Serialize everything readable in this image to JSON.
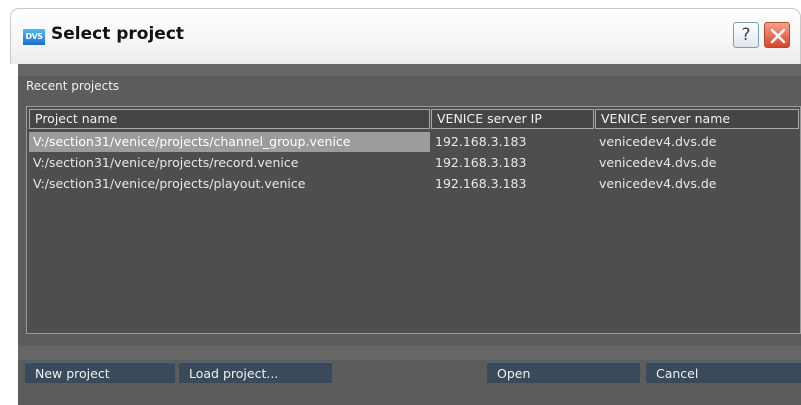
{
  "window": {
    "title": "Select project",
    "logo_text": "DVS",
    "help_label": "?"
  },
  "recent": {
    "label": "Recent projects",
    "columns": [
      "Project name",
      "VENICE server IP",
      "VENICE server name"
    ],
    "rows": [
      {
        "name": "V:/section31/venice/projects/channel_group.venice",
        "ip": "192.168.3.183",
        "server": "venicedev4.dvs.de",
        "selected": true
      },
      {
        "name": "V:/section31/venice/projects/record.venice",
        "ip": "192.168.3.183",
        "server": "venicedev4.dvs.de",
        "selected": false
      },
      {
        "name": "V:/section31/venice/projects/playout.venice",
        "ip": "192.168.3.183",
        "server": "venicedev4.dvs.de",
        "selected": false
      }
    ]
  },
  "buttons": {
    "new_project": "New project",
    "load_project": "Load project...",
    "open": "Open",
    "cancel": "Cancel"
  },
  "colors": {
    "dialog_bg": "#5c5c5c",
    "button_bg": "#3b4a5b",
    "selection": "#9c9c9c"
  }
}
